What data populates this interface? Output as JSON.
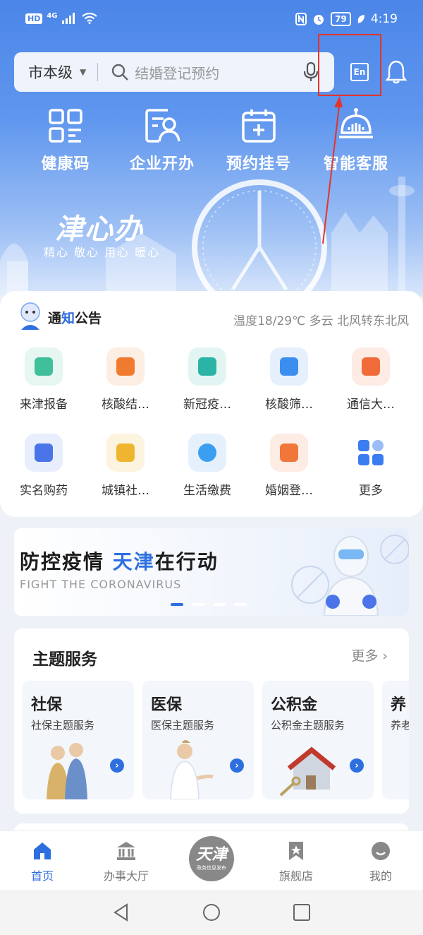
{
  "status_bar": {
    "hd": "HD",
    "network": "4G",
    "battery": "79",
    "time": "4:19"
  },
  "search": {
    "region": "市本级",
    "placeholder": "结婚登记预约"
  },
  "en_button": "En",
  "quick_actions": [
    "健康码",
    "企业开办",
    "预约挂号",
    "智能客服"
  ],
  "brand": {
    "logo": "津心办",
    "slogan": "精心 敬心 用心 暖心"
  },
  "notice": {
    "title_part1": "通",
    "title_part2": "知",
    "title_part3": "公告",
    "weather": "温度18/29℃ 多云 北风转东北风"
  },
  "services_grid": [
    {
      "label": "来津报备",
      "color": "#3fbf9a",
      "bg": "#e6f6f1"
    },
    {
      "label": "核酸结…",
      "color": "#f07a2e",
      "bg": "#fdeee4"
    },
    {
      "label": "新冠疫…",
      "color": "#2bb3a6",
      "bg": "#e3f5f3"
    },
    {
      "label": "核酸筛…",
      "color": "#3b8ef0",
      "bg": "#e6f0fd"
    },
    {
      "label": "通信大…",
      "color": "#f06a3a",
      "bg": "#fdebe4"
    },
    {
      "label": "实名购药",
      "color": "#4a74e8",
      "bg": "#e8eefc"
    },
    {
      "label": "城镇社…",
      "color": "#f0b52e",
      "bg": "#fdf4e0"
    },
    {
      "label": "生活缴费",
      "color": "#3b9ef0",
      "bg": "#e4f1fd"
    },
    {
      "label": "婚姻登…",
      "color": "#f0763a",
      "bg": "#fdece4"
    },
    {
      "label": "更多",
      "color": "#3b7cf0",
      "bg": "#ffffff"
    }
  ],
  "banner": {
    "title_part1": "防控疫情 ",
    "title_part2": "天津",
    "title_part3": "在行动",
    "subtitle": "FIGHT THE CORONAVIRUS"
  },
  "theme_services": {
    "title": "主题服务",
    "more": "更多",
    "items": [
      {
        "title": "社保",
        "subtitle": "社保主题服务"
      },
      {
        "title": "医保",
        "subtitle": "医保主题服务"
      },
      {
        "title": "公积金",
        "subtitle": "公积金主题服务"
      },
      {
        "title": "养",
        "subtitle": "养老"
      }
    ]
  },
  "tabbar": {
    "items": [
      "首页",
      "办事大厅",
      "旗舰店",
      "我的"
    ],
    "center_logo": "天津",
    "center_logo_sub": "政务信息发布"
  },
  "colors": {
    "primary": "#2e6fe0",
    "hero": "#4b86e8",
    "highlight_box": "#e5332a"
  }
}
